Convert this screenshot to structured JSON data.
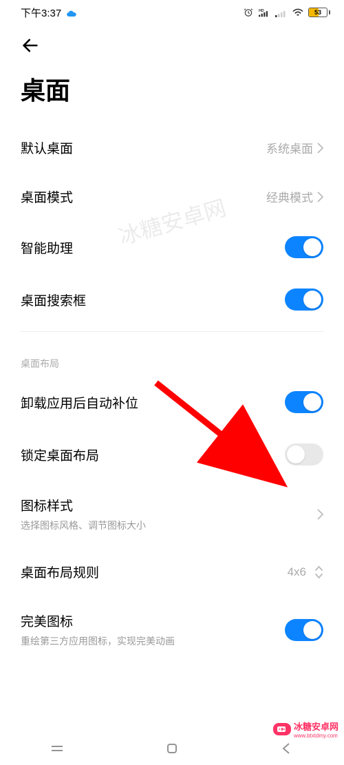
{
  "status": {
    "time": "下午3:37",
    "battery": "53"
  },
  "page": {
    "title": "桌面"
  },
  "rows": {
    "default_desktop": {
      "label": "默认桌面",
      "value": "系统桌面"
    },
    "desktop_mode": {
      "label": "桌面模式",
      "value": "经典模式"
    },
    "smart_assistant": {
      "label": "智能助理"
    },
    "desktop_search": {
      "label": "桌面搜索框"
    },
    "section_layout": "桌面布局",
    "auto_fill": {
      "label": "卸载应用后自动补位"
    },
    "lock_layout": {
      "label": "锁定桌面布局"
    },
    "icon_style": {
      "label": "图标样式",
      "sub": "选择图标风格、调节图标大小"
    },
    "layout_rule": {
      "label": "桌面布局规则",
      "value": "4x6"
    },
    "perfect_icon": {
      "label": "完美图标",
      "sub": "重绘第三方应用图标，实现完美动画"
    }
  },
  "watermark": {
    "center": "冰糖安卓网",
    "bottom_brand": "冰糖安卓网",
    "bottom_url": "www.btxtdmy.com"
  }
}
